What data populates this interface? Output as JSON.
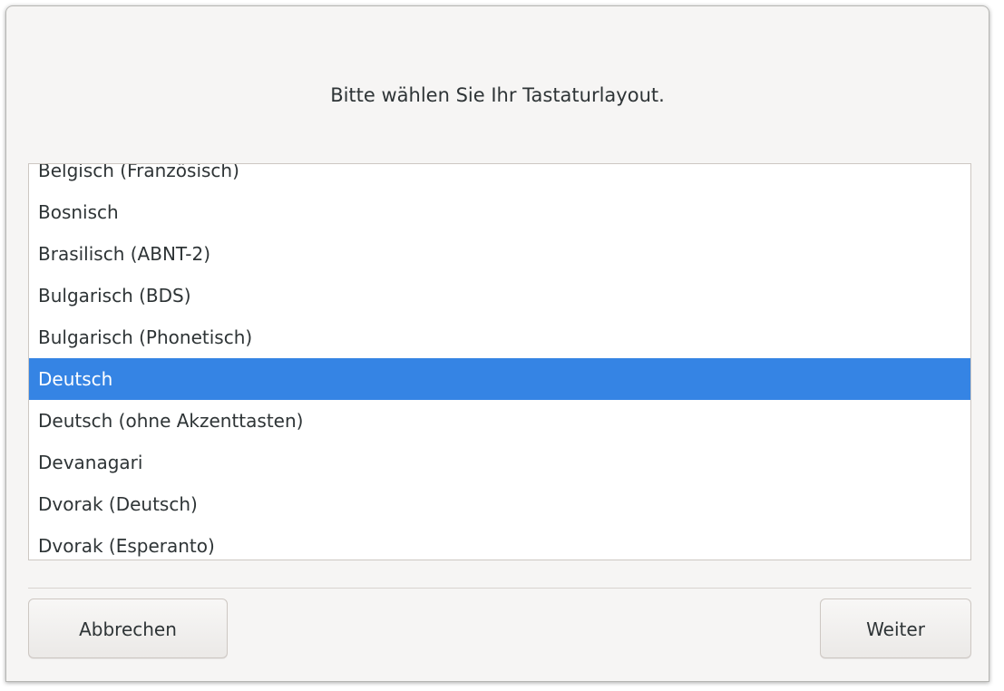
{
  "dialog": {
    "prompt": "Bitte wählen Sie Ihr Tastaturlayout."
  },
  "layout_list": {
    "items": [
      {
        "label": "Belgisch (Französisch)"
      },
      {
        "label": "Bosnisch"
      },
      {
        "label": "Brasilisch (ABNT-2)"
      },
      {
        "label": "Bulgarisch (BDS)"
      },
      {
        "label": "Bulgarisch (Phonetisch)"
      },
      {
        "label": "Deutsch"
      },
      {
        "label": "Deutsch (ohne Akzenttasten)"
      },
      {
        "label": "Devanagari"
      },
      {
        "label": "Dvorak (Deutsch)"
      },
      {
        "label": "Dvorak (Esperanto)"
      }
    ],
    "selected": "Deutsch"
  },
  "buttons": {
    "cancel_label": "Abbrechen",
    "next_label": "Weiter"
  },
  "colors": {
    "selection": "#3584e4",
    "background": "#f6f5f4"
  }
}
